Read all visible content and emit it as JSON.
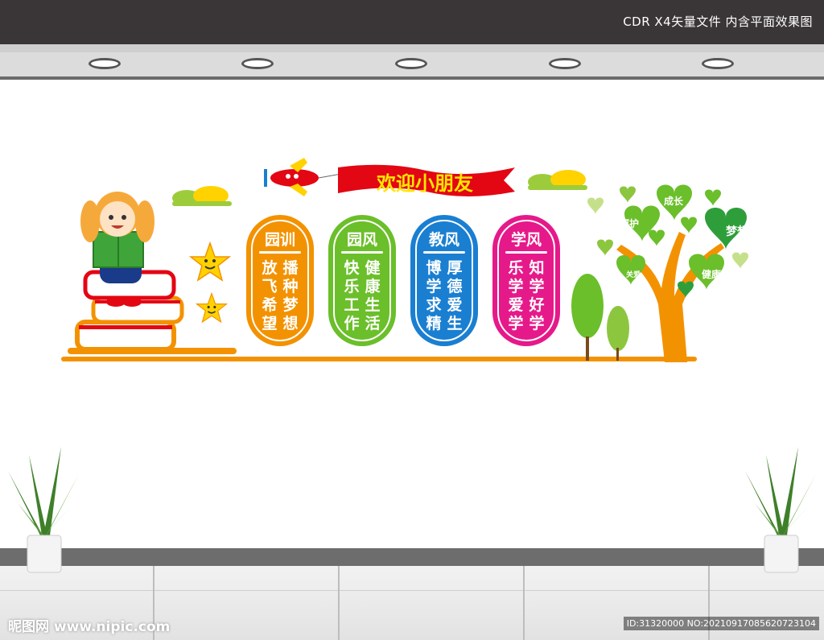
{
  "header": {
    "title": "CDR X4矢量文件  内含平面效果图"
  },
  "banner": {
    "text": "欢迎小朋友"
  },
  "panels": [
    {
      "heading": "园训",
      "columns": [
        "放飞希望",
        "播种梦想"
      ],
      "color": "#f39200"
    },
    {
      "heading": "园风",
      "columns": [
        "快乐工作",
        "健康生活"
      ],
      "color": "#6bbf2a"
    },
    {
      "heading": "教风",
      "columns": [
        "博学求精",
        "厚德爱生"
      ],
      "color": "#1a7fd1"
    },
    {
      "heading": "学风",
      "columns": [
        "乐学爱学",
        "知学好学"
      ],
      "color": "#e6198a"
    }
  ],
  "tree_labels": {
    "chengzhang": "成长",
    "hehu": "呵护",
    "mengxiang": "梦想",
    "guanai": "关爱",
    "jiankang": "健康"
  },
  "footer": {
    "watermark": "昵图网 www.nipic.com",
    "id": "ID:31320000 NO:20210917085620723104"
  },
  "colors": {
    "accent_orange": "#f39200",
    "green": "#6bbf2a",
    "blue": "#1a7fd1",
    "pink": "#e6198a",
    "banner_red": "#e30613",
    "banner_text": "#ffe600"
  }
}
